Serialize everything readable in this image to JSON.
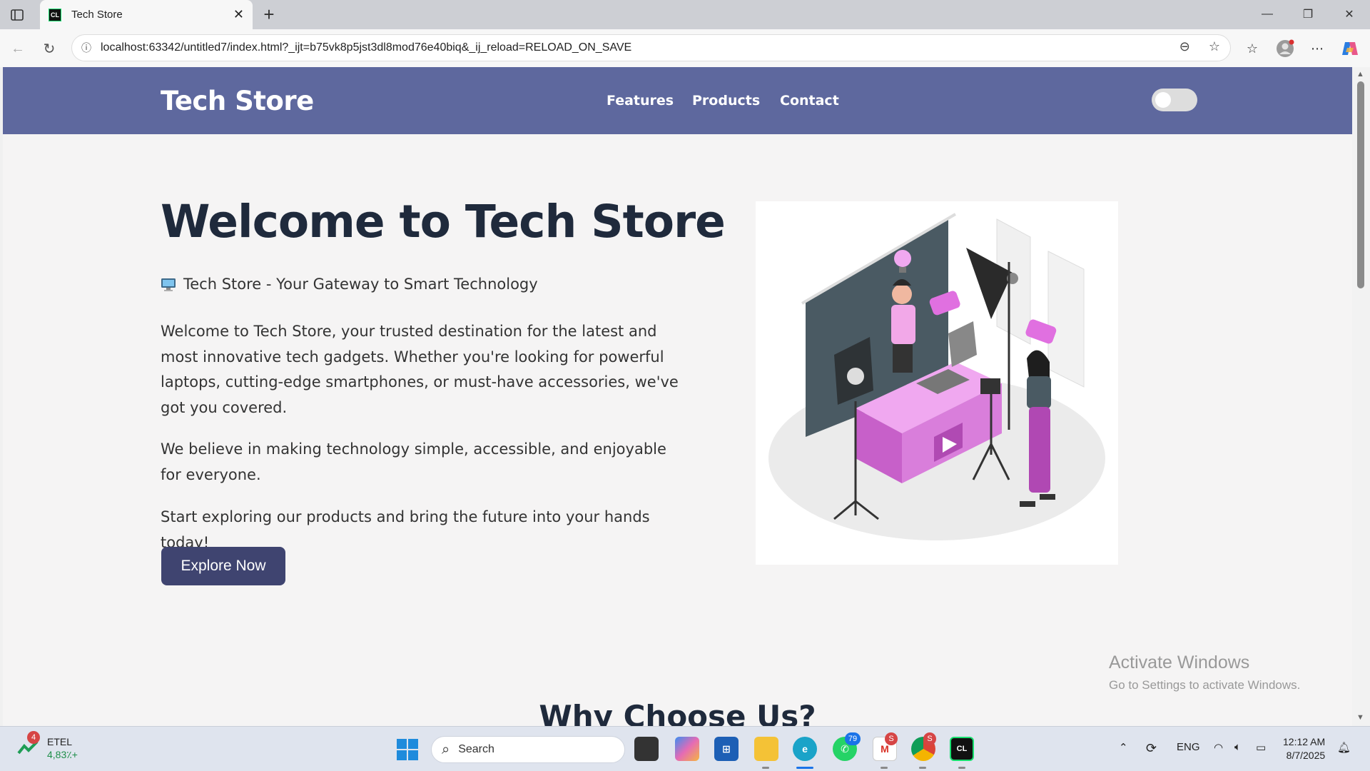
{
  "browser": {
    "tab_title": "Tech Store",
    "tab_favicon_text": "CL",
    "url": "localhost:63342/untitled7/index.html?_ijt=b75vk8p5jst3dl8mod76e40biq&_ij_reload=RELOAD_ON_SAVE"
  },
  "site": {
    "brand": "Tech Store",
    "nav": [
      "Features",
      "Products",
      "Contact"
    ],
    "theme_toggle_on": false
  },
  "hero": {
    "title": "Welcome to Tech Store",
    "tagline": "Tech Store - Your Gateway to Smart Technology",
    "paragraph1": "Welcome to Tech Store, your trusted destination for the latest and most innovative tech gadgets. Whether you're looking for powerful laptops, cutting-edge smartphones, or must-have accessories, we've got you covered.",
    "paragraph2": "We believe in making technology simple, accessible, and enjoyable for everyone.",
    "paragraph3": "Start exploring our products and bring the future into your hands today!",
    "cta": "Explore Now"
  },
  "section": {
    "why_title": "Why Choose Us?"
  },
  "watermark": {
    "line1": "Activate Windows",
    "line2": "Go to Settings to activate Windows."
  },
  "taskbar": {
    "stock_badge": "4",
    "stock_name": "ETEL",
    "stock_value": "4,83٪+",
    "search_placeholder": "Search",
    "whatsapp_badge": "79",
    "gmail_badge": "S",
    "chrome_badge": "S",
    "language": "ENG",
    "time": "12:12 AM",
    "date": "8/7/2025"
  },
  "colors": {
    "header_bg": "#5e689e",
    "button_bg": "#3f4470",
    "page_bg": "#f5f4f4",
    "title_color": "#1f2a3c"
  }
}
